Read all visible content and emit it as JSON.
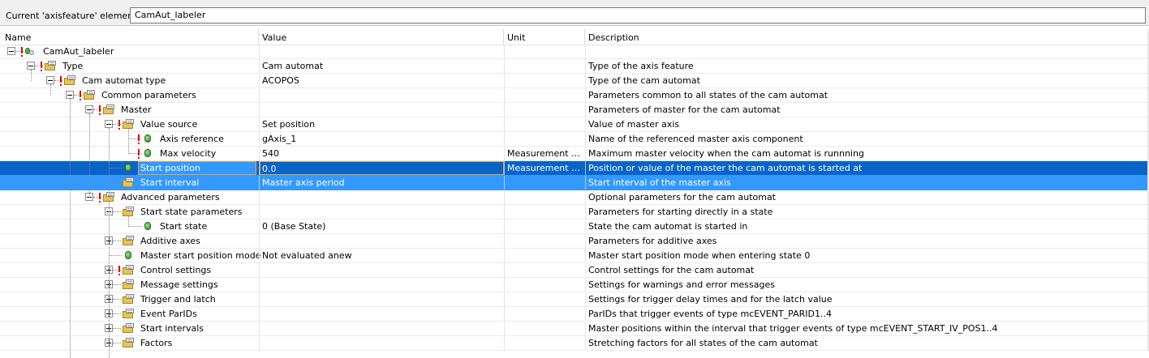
{
  "element_bar": {
    "label": "Current 'axisfeature' element:",
    "value": "CamAut_labeler"
  },
  "columns": {
    "name": "Name",
    "value": "Value",
    "unit": "Unit",
    "description": "Description"
  },
  "rows": [
    {
      "name": "CamAut_labeler",
      "value": "",
      "unit": "",
      "description": ""
    },
    {
      "name": "Type",
      "value": "Cam automat",
      "unit": "",
      "description": "Type of the axis feature"
    },
    {
      "name": "Cam automat type",
      "value": "ACOPOS",
      "unit": "",
      "description": "Type of the cam automat"
    },
    {
      "name": "Common parameters",
      "value": "",
      "unit": "",
      "description": "Parameters common to all states of the cam automat"
    },
    {
      "name": "Master",
      "value": "",
      "unit": "",
      "description": "Parameters of master for the cam automat"
    },
    {
      "name": "Value source",
      "value": "Set position",
      "unit": "",
      "description": "Value of master axis"
    },
    {
      "name": "Axis reference",
      "value": "gAxis_1",
      "unit": "",
      "description": "Name of the referenced master axis component"
    },
    {
      "name": "Max velocity",
      "value": "540",
      "unit": "Measurement unit...",
      "description": "Maximum master velocity when the cam automat is runnning"
    },
    {
      "name": "Start position",
      "value": "0.0",
      "unit": "Measurement unit...",
      "description": "Position or value of the master the cam automat is started at"
    },
    {
      "name": "Start interval",
      "value": "Master axis period",
      "unit": "",
      "description": "Start interval of the master axis"
    },
    {
      "name": "Advanced parameters",
      "value": "",
      "unit": "",
      "description": "Optional parameters for the cam automat"
    },
    {
      "name": "Start state parameters",
      "value": "",
      "unit": "",
      "description": "Parameters for starting directly in a state"
    },
    {
      "name": "Start state",
      "value": "0 (Base State)",
      "unit": "",
      "description": "State the cam automat is started in"
    },
    {
      "name": "Additive axes",
      "value": "",
      "unit": "",
      "description": "Parameters for additive axes"
    },
    {
      "name": "Master start position mode",
      "value": "Not evaluated anew",
      "unit": "",
      "description": "Master start position mode when entering state 0"
    },
    {
      "name": "Control settings",
      "value": "",
      "unit": "",
      "description": "Control settings for the cam automat"
    },
    {
      "name": "Message settings",
      "value": "",
      "unit": "",
      "description": "Settings for warnings and error messages"
    },
    {
      "name": "Trigger and latch",
      "value": "",
      "unit": "",
      "description": "Settings for trigger delay times and for the latch value"
    },
    {
      "name": "Event ParIDs",
      "value": "",
      "unit": "",
      "description": "ParIDs that trigger events of type mcEVENT_PARID1..4"
    },
    {
      "name": "Start intervals",
      "value": "",
      "unit": "",
      "description": "Master positions within the interval that trigger events of type mcEVENT_START_IV_POS1..4"
    },
    {
      "name": "Factors",
      "value": "",
      "unit": "",
      "description": "Stretching factors for all states of the cam automat"
    }
  ],
  "icons": {
    "root": "axis-feature-icon",
    "group": "parameter-group-icon",
    "leaf": "parameter-leaf-icon",
    "warning": "warning-marker-icon"
  },
  "colors": {
    "selection": "#3399ff",
    "edit_border": "#f3a032",
    "warning": "#e00000"
  }
}
